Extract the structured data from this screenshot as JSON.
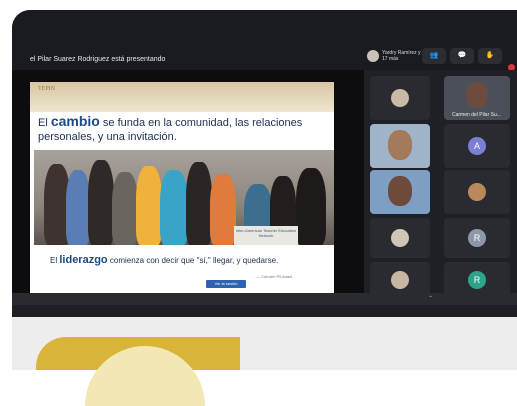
{
  "meeting": {
    "presenter_status": "el Pilar Suarez Rodriguez está presentando",
    "raised_hand": "Yardry Ramírez y 17 más",
    "controls": [
      "👥",
      "💬",
      "✋"
    ],
    "notification_count": ""
  },
  "slide": {
    "brand": "TEPIN",
    "heading_prefix": "El",
    "heading_bold": "cambio",
    "heading_rest": "se funda en la comunidad, las relaciones personales, y una invitación.",
    "banner_text": "Inter-American Teacher Education Network",
    "quote_prefix": "El",
    "quote_bold": "liderazgo",
    "quote_rest": "comienza con decir que \"sí,\" llegar, y quedarse.",
    "quote_source": "— Carmen Pil.Adani",
    "button_label": "Ver la sesión"
  },
  "participants": [
    {
      "name": "",
      "type": "avatar",
      "color": "#c9b9a6"
    },
    {
      "name": "Carmen del Pilar Su...",
      "type": "video",
      "color": "#6d4b3e"
    },
    {
      "name": "",
      "type": "video",
      "color": "#5a7fa8"
    },
    {
      "name": "",
      "type": "letter",
      "letter": "A",
      "color": "#7b7fd4"
    },
    {
      "name": "",
      "type": "video",
      "color": "#3d6fa8"
    },
    {
      "name": "",
      "type": "avatar",
      "color": "#b88a5b"
    },
    {
      "name": "",
      "type": "avatar",
      "color": "#d0c6b5"
    },
    {
      "name": "",
      "type": "letter",
      "letter": "R",
      "color": "#8d99ab"
    },
    {
      "name": "",
      "type": "avatar",
      "color": "#c7b7a2"
    },
    {
      "name": "",
      "type": "letter",
      "letter": "R",
      "color": "#2fa28a"
    }
  ],
  "bottom_hint": "⌃"
}
